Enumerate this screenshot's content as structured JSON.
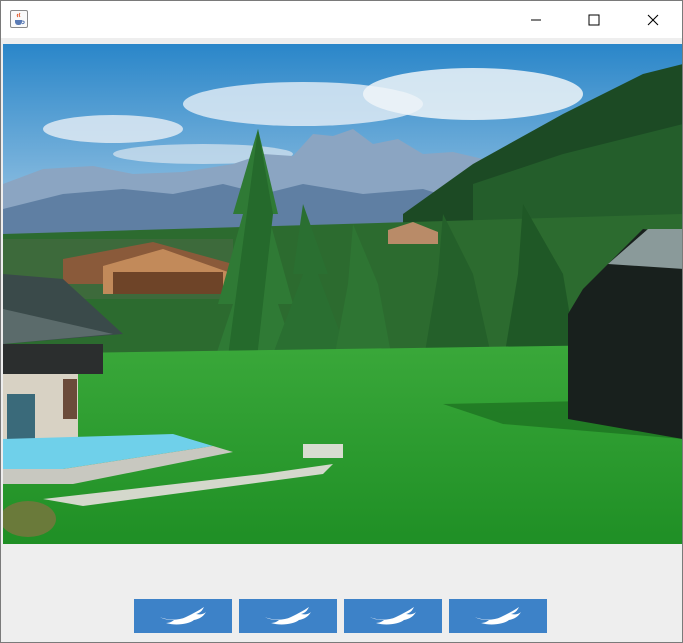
{
  "window": {
    "icon": "java-coffee-cup-icon",
    "controls": [
      "minimize-icon",
      "maximize-icon",
      "close-icon"
    ]
  },
  "image": {
    "subject": "landscape-photo"
  },
  "buttons": [
    {
      "icon": "twitter-bird-icon"
    },
    {
      "icon": "twitter-bird-icon"
    },
    {
      "icon": "twitter-bird-icon"
    },
    {
      "icon": "twitter-bird-icon"
    }
  ],
  "colors": {
    "button_bg": "#3d82c8",
    "titlebar_bg": "#ffffff",
    "content_bg": "#eeeeee"
  }
}
